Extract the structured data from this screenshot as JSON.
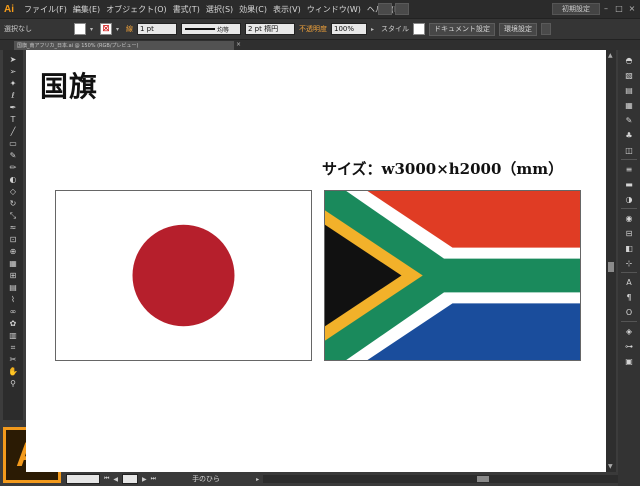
{
  "app": {
    "icon_text": "Ai",
    "logo_text": "Ai"
  },
  "menu": {
    "items": [
      "ファイル(F)",
      "編集(E)",
      "オブジェクト(O)",
      "書式(T)",
      "選択(S)",
      "効果(C)",
      "表示(V)",
      "ウィンドウ(W)",
      "ヘルプ(H)"
    ],
    "workspace": "初期設定",
    "window_buttons": [
      "–",
      "□",
      "×"
    ]
  },
  "control": {
    "selection": "選択なし",
    "stroke_label": "線",
    "stroke_value": "1 pt",
    "line_style": "均等",
    "brush": "2 pt 楕円",
    "opacity_label": "不透明度",
    "opacity_value": "100%",
    "style_label": "スタイル",
    "doc_setup": "ドキュメント設定",
    "preferences": "環境設定"
  },
  "document": {
    "tab_title": "国旗_南アフリカ_日本.ai @ 150% (RGB/プレビュー)",
    "close": "×"
  },
  "canvas": {
    "title": "国旗",
    "size_label": "サイズ：w3000×h2000（mm）"
  },
  "flags": {
    "japan": {
      "background": "#ffffff",
      "disc": "#b61f2c"
    },
    "south_africa": {
      "red": "#e03c24",
      "blue": "#1a4d9c",
      "green": "#1a8a5c",
      "black": "#111111",
      "gold": "#f2b12a",
      "white": "#ffffff"
    }
  },
  "status": {
    "tool_name": "手のひら"
  },
  "icons": {
    "tools": [
      "selection-arrow-icon",
      "direct-selection-icon",
      "magic-wand-icon",
      "lasso-icon",
      "pen-icon",
      "type-icon",
      "line-icon",
      "rectangle-icon",
      "paintbrush-icon",
      "pencil-icon",
      "blob-brush-icon",
      "eraser-icon",
      "rotate-icon",
      "scale-icon",
      "warp-icon",
      "free-transform-icon",
      "shape-builder-icon",
      "perspective-grid-icon",
      "mesh-icon",
      "gradient-icon",
      "eyedropper-icon",
      "blend-icon",
      "symbol-sprayer-icon",
      "column-graph-icon",
      "artboard-icon",
      "slice-icon",
      "hand-icon",
      "zoom-icon"
    ],
    "panels": [
      "color-icon",
      "color-guide-icon",
      "kuler-icon",
      "swatches-icon",
      "brushes-icon",
      "symbols-icon",
      "graphic-styles-icon",
      "stroke-icon",
      "gradient-icon",
      "transparency-icon",
      "appearance-icon",
      "align-icon",
      "pathfinder-icon",
      "transform-icon",
      "character-icon",
      "paragraph-icon",
      "opentype-icon",
      "layers-icon",
      "links-icon",
      "artboards-icon"
    ]
  }
}
